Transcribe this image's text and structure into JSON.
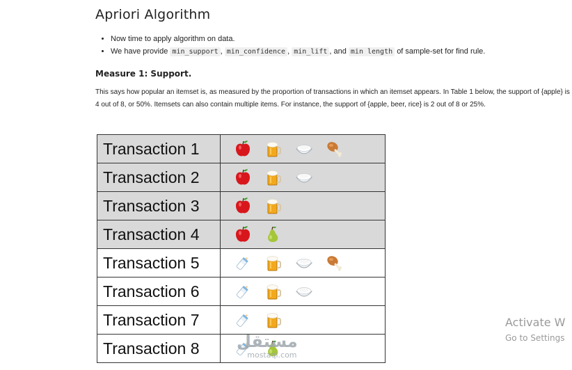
{
  "title": "Apriori Algorithm",
  "bullets": {
    "b1": "Now time to apply algorithm on data.",
    "b2_prefix": "We have provide",
    "code1": "min_support",
    "sep1": ",",
    "code2": "min_confidence",
    "sep2": ",",
    "code3": "min_lift",
    "sep3": ", and",
    "code4": "min length",
    "b2_suffix": "of sample-set for find rule."
  },
  "measure_heading": "Measure 1: Support.",
  "description": "This says how popular an itemset is, as measured by the proportion of transactions in which an itemset appears. In Table 1 below, the support of {apple} is 4 out of 8, or 50%. Itemsets can also contain multiple items. For instance, the support of {apple, beer, rice} is 2 out of 8 or 25%.",
  "transactions": [
    {
      "label": "Transaction 1",
      "items": [
        "apple-icon",
        "beer-icon",
        "rice-icon",
        "chicken-icon"
      ]
    },
    {
      "label": "Transaction 2",
      "items": [
        "apple-icon",
        "beer-icon",
        "rice-icon"
      ]
    },
    {
      "label": "Transaction 3",
      "items": [
        "apple-icon",
        "beer-icon"
      ]
    },
    {
      "label": "Transaction 4",
      "items": [
        "apple-icon",
        "pear-icon"
      ]
    },
    {
      "label": "Transaction 5",
      "items": [
        "milk-icon",
        "beer-icon",
        "rice-icon",
        "chicken-icon"
      ]
    },
    {
      "label": "Transaction 6",
      "items": [
        "milk-icon",
        "beer-icon",
        "rice-icon"
      ]
    },
    {
      "label": "Transaction 7",
      "items": [
        "milk-icon",
        "beer-icon"
      ]
    },
    {
      "label": "Transaction 8",
      "items": [
        "milk-icon",
        "pear-icon"
      ]
    }
  ],
  "overlay": {
    "activate_line1": "Activate W",
    "activate_line2": "Go to Settings",
    "watermark_arabic": "مستقل",
    "watermark_url": "mostaql.com"
  },
  "colors": {
    "row_gray": "#d9d9d9",
    "row_white": "#ffffff",
    "apple": "#d8171c",
    "beer": "#f2a91c",
    "pear": "#a4c639"
  }
}
